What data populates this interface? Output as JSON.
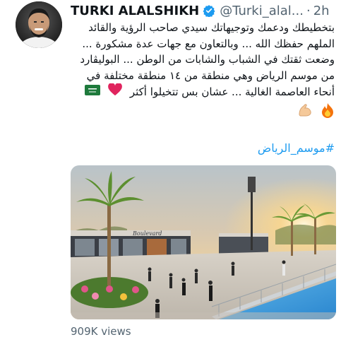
{
  "tweet": {
    "author_name": "TURKI ALALSHIKH",
    "handle": "@Turki_alal...",
    "separator": "·",
    "time": "2h",
    "lines": [
      "بتخطيطك ودعمك وتوجيهاتك سيدي صاحب الرؤية والقائد",
      "الملهم حفظك الله ... وبالتعاون مع جهات عدة مشكورة ...",
      "وضعت ثقتك في الشباب والشابات من الوطن ... البوليڤارد",
      "من موسم الرياض وهي منطقة من ١٤ منطقة مختلفة في",
      "أنحاء العاصمة الغالية ... عشان بس تتخيلوا أكثر"
    ],
    "hashtag": "#موسم_الرياض",
    "views": "909K views",
    "image_sign_text": "Boulevard"
  },
  "colors": {
    "link": "#1d9bf0",
    "muted": "#536471",
    "verified_badge": "#1d9bf0"
  },
  "icons": [
    "avatar-photo",
    "verified-badge-icon",
    "saudi-flag-icon",
    "red-heart-icon",
    "flexed-biceps-icon",
    "fire-icon"
  ]
}
